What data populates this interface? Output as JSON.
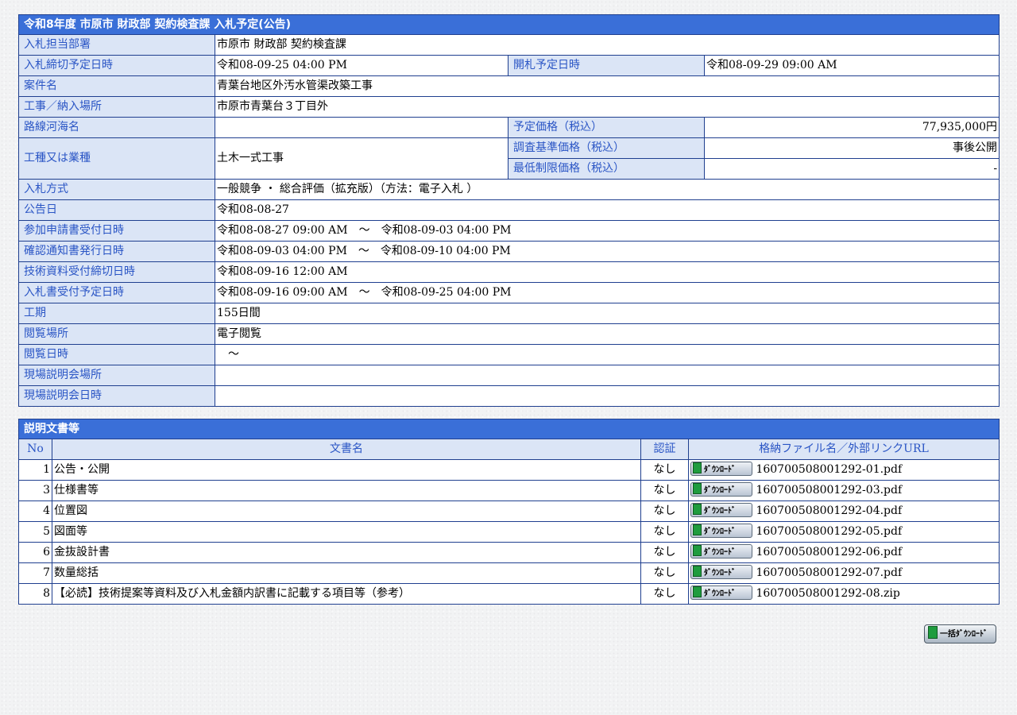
{
  "info": {
    "title": "令和8年度 市原市 財政部 契約検査課 入札予定(公告)",
    "dept_label": "入札担当部署",
    "dept_value": "市原市 財政部 契約検査課",
    "deadline_label": "入札締切予定日時",
    "deadline_value": "令和08-09-25 04:00 PM",
    "opening_label": "開札予定日時",
    "opening_value": "令和08-09-29 09:00 AM",
    "case_label": "案件名",
    "case_value": "青葉台地区外汚水管渠改築工事",
    "place_label": "工事／納入場所",
    "place_value": "市原市青葉台３丁目外",
    "route_label": "路線河海名",
    "route_value": "",
    "planned_price_label": "予定価格（税込）",
    "planned_price_value": "77,935,000円",
    "type_label": "工種又は業種",
    "type_value": "土木一式工事",
    "survey_price_label": "調査基準価格（税込）",
    "survey_price_value": "事後公開",
    "min_price_label": "最低制限価格（税込）",
    "min_price_value": "-",
    "method_label": "入札方式",
    "method_value": "一般競争 ・ 総合評価（拡充版）（方法：電子入札 ）",
    "notice_date_label": "公告日",
    "notice_date_value": "令和08-08-27",
    "application_label": "参加申請書受付日時",
    "application_value": "令和08-08-27 09:00 AM　～　令和08-09-03 04:00 PM",
    "confirmation_label": "確認通知書発行日時",
    "confirmation_value": "令和08-09-03 04:00 PM　～　令和08-09-10 04:00 PM",
    "tech_label": "技術資料受付締切日時",
    "tech_value": "令和08-09-16 12:00 AM",
    "bid_accept_label": "入札書受付予定日時",
    "bid_accept_value": "令和08-09-16 09:00 AM　～　令和08-09-25 04:00 PM",
    "period_label": "工期",
    "period_value": "155日間",
    "view_place_label": "閲覧場所",
    "view_place_value": "電子閲覧",
    "view_date_label": "閲覧日時",
    "view_date_value": "　～",
    "site_place_label": "現場説明会場所",
    "site_place_value": "",
    "site_date_label": "現場説明会日時",
    "site_date_value": ""
  },
  "docs": {
    "title": "説明文書等",
    "headers": {
      "no": "No",
      "name": "文書名",
      "auth": "認証",
      "file": "格納ファイル名／外部リンクURL"
    },
    "download_label": "ﾀﾞｳﾝﾛｰﾄﾞ",
    "rows": [
      {
        "no": "1",
        "name": "公告・公開",
        "auth": "なし",
        "file": "160700508001292-01.pdf"
      },
      {
        "no": "3",
        "name": "仕様書等",
        "auth": "なし",
        "file": "160700508001292-03.pdf"
      },
      {
        "no": "4",
        "name": "位置図",
        "auth": "なし",
        "file": "160700508001292-04.pdf"
      },
      {
        "no": "5",
        "name": "図面等",
        "auth": "なし",
        "file": "160700508001292-05.pdf"
      },
      {
        "no": "6",
        "name": "金抜設計書",
        "auth": "なし",
        "file": "160700508001292-06.pdf"
      },
      {
        "no": "7",
        "name": "数量総括",
        "auth": "なし",
        "file": "160700508001292-07.pdf"
      },
      {
        "no": "8",
        "name": "【必読】技術提案等資料及び入札金額内訳書に記載する項目等（参考）",
        "auth": "なし",
        "file": "160700508001292-08.zip"
      }
    ],
    "bulk_download_label": "一括ﾀﾞｳﾝﾛｰﾄﾞ"
  }
}
